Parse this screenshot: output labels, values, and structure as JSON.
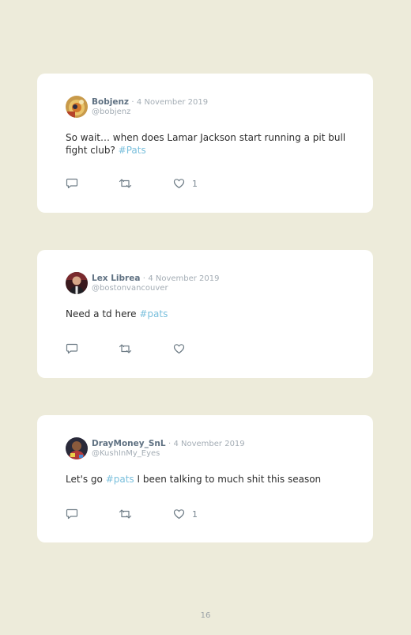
{
  "tweets": [
    {
      "name": "Bobjenz",
      "date": "4 November 2019",
      "handle": "@bobjenz",
      "text_before": "So wait… when does Lamar Jackson start running a pit bull fight club? ",
      "hashtag": "#Pats",
      "text_after": "",
      "likes": "1"
    },
    {
      "name": "Lex Librea",
      "date": "4 November 2019",
      "handle": "@bostonvancouver",
      "text_before": "Need a td here ",
      "hashtag": "#pats",
      "text_after": "",
      "likes": ""
    },
    {
      "name": "DrayMoney_SnL",
      "date": "4 November 2019",
      "handle": "@KushInMy_Eyes",
      "text_before": "Let's go ",
      "hashtag": "#pats",
      "text_after": " I been talking to much shit this season",
      "likes": "1"
    }
  ],
  "separator": "·",
  "page_number": "16",
  "colors": {
    "background": "#edebda",
    "card": "#ffffff",
    "name": "#5f7182",
    "hashtag": "#79bfdc",
    "muted": "#a4adb5"
  },
  "icons": [
    "reply-icon",
    "retweet-icon",
    "like-icon"
  ]
}
